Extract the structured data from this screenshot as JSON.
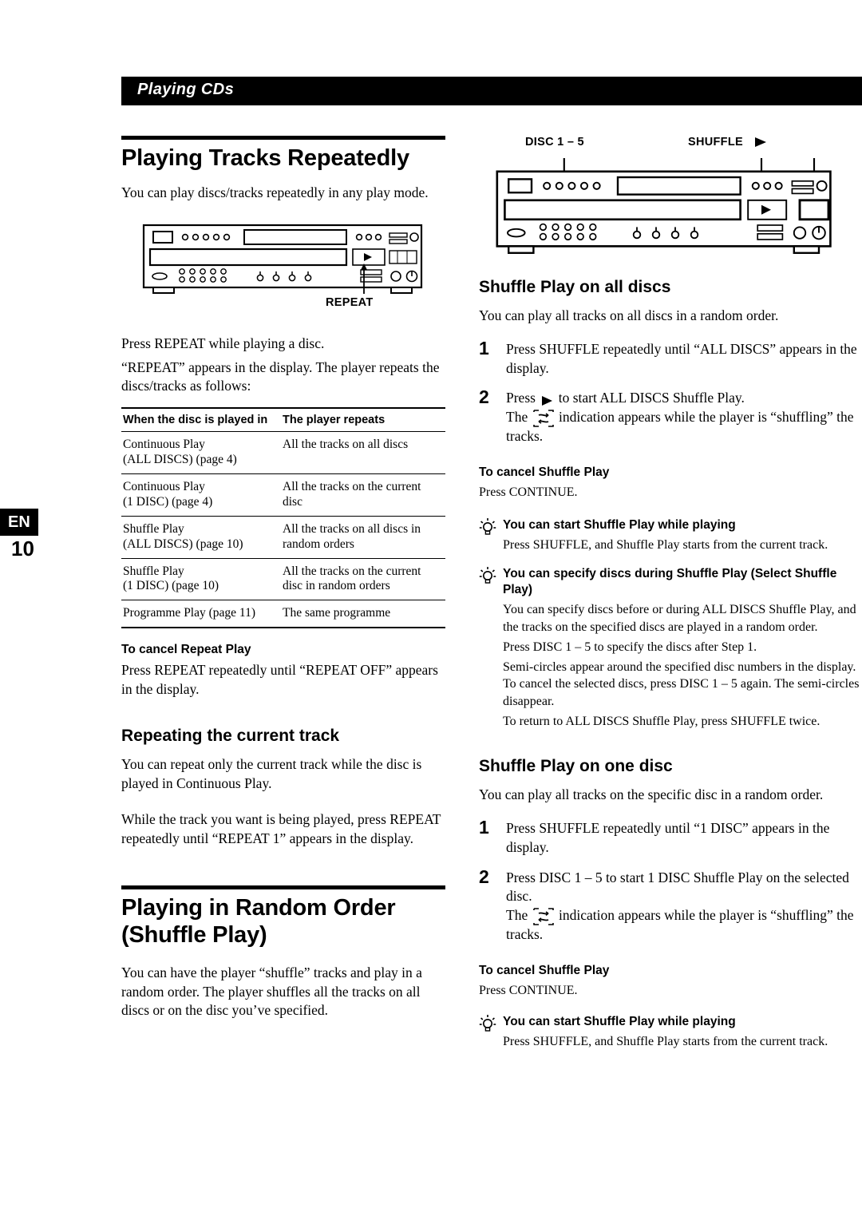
{
  "header": {
    "title": "Playing CDs"
  },
  "sidetab": {
    "lang": "EN",
    "page": "10"
  },
  "left": {
    "section_title": "Playing Tracks Repeatedly",
    "intro": "You can play discs/tracks repeatedly in any play mode.",
    "diagram_label": "REPEAT",
    "body1": "Press REPEAT while playing a disc.",
    "body2": "“REPEAT” appears in the display. The player repeats the discs/tracks as follows:",
    "table": {
      "headers": [
        "When the disc is played in",
        "The player repeats"
      ],
      "rows": [
        [
          "Continuous Play\n(ALL DISCS) (page 4)",
          "All the tracks on all discs"
        ],
        [
          "Continuous Play\n(1 DISC) (page 4)",
          "All the tracks on the current disc"
        ],
        [
          "Shuffle Play\n(ALL DISCS) (page 10)",
          "All the tracks on all discs in random orders"
        ],
        [
          "Shuffle Play\n(1 DISC) (page 10)",
          "All the tracks on the current disc in random orders"
        ],
        [
          "Programme Play (page 11)",
          "The same programme"
        ]
      ]
    },
    "cancel_heading": "To cancel Repeat Play",
    "cancel_body": "Press REPEAT repeatedly until “REPEAT OFF” appears in the display.",
    "sub_heading": "Repeating the current track",
    "sub_body1": "You can repeat only the current track while the disc is played in Continuous Play.",
    "sub_body2": "While the track you want is being played, press REPEAT repeatedly until “REPEAT 1” appears in the display.",
    "section2_title_line1": "Playing in Random Order",
    "section2_title_line2": "(Shuffle Play)",
    "section2_body": "You can have the player “shuffle” tracks and play in a random order. The player shuffles all the tracks on all discs or on the disc you’ve specified."
  },
  "right": {
    "diagram_label_left": "DISC 1 – 5",
    "diagram_label_right": "SHUFFLE",
    "heading_all": "Shuffle Play on all discs",
    "body_all": "You can play all tracks on all discs in a random order.",
    "steps_all": [
      {
        "n": "1",
        "text": "Press SHUFFLE repeatedly until “ALL DISCS” appears in the display."
      },
      {
        "n": "2",
        "text_before": "Press",
        "text_after": "to start ALL DISCS Shuffle Play.",
        "line2_before": "The",
        "line2_after": "indication appears while the player is “shuffling” the tracks."
      }
    ],
    "cancel_heading_1": "To cancel Shuffle Play",
    "cancel_body_1": "Press CONTINUE.",
    "tip1_heading": "You can start Shuffle Play while playing",
    "tip1_body": "Press SHUFFLE, and Shuffle Play starts from the current track.",
    "tip2_heading": "You can specify discs during Shuffle Play (Select Shuffle Play)",
    "tip2_body1": "You can specify discs before or during ALL DISCS Shuffle Play, and the tracks on the specified discs are played in a random order.",
    "tip2_body2": "Press DISC 1 – 5 to specify the discs after Step 1.",
    "tip2_body3": "Semi-circles appear around the specified disc numbers in the display. To cancel the selected discs, press DISC 1 – 5 again. The semi-circles disappear.",
    "tip2_body4": "To return to ALL DISCS Shuffle Play, press SHUFFLE twice.",
    "heading_one": "Shuffle Play on one disc",
    "body_one": "You can play all tracks on the specific disc in a random order.",
    "steps_one": [
      {
        "n": "1",
        "text": "Press SHUFFLE repeatedly until “1 DISC” appears in the display."
      },
      {
        "n": "2",
        "text": "Press DISC 1 – 5 to start 1 DISC Shuffle Play on the selected disc.",
        "line2_before": "The",
        "line2_after": "indication appears while the player is “shuffling” the tracks."
      }
    ],
    "cancel_heading_2": "To cancel Shuffle Play",
    "cancel_body_2": "Press CONTINUE.",
    "tip3_heading": "You can start Shuffle Play while playing",
    "tip3_body": "Press SHUFFLE, and Shuffle Play starts from the current track."
  },
  "colors": {
    "ink": "#000000",
    "paper": "#ffffff"
  }
}
